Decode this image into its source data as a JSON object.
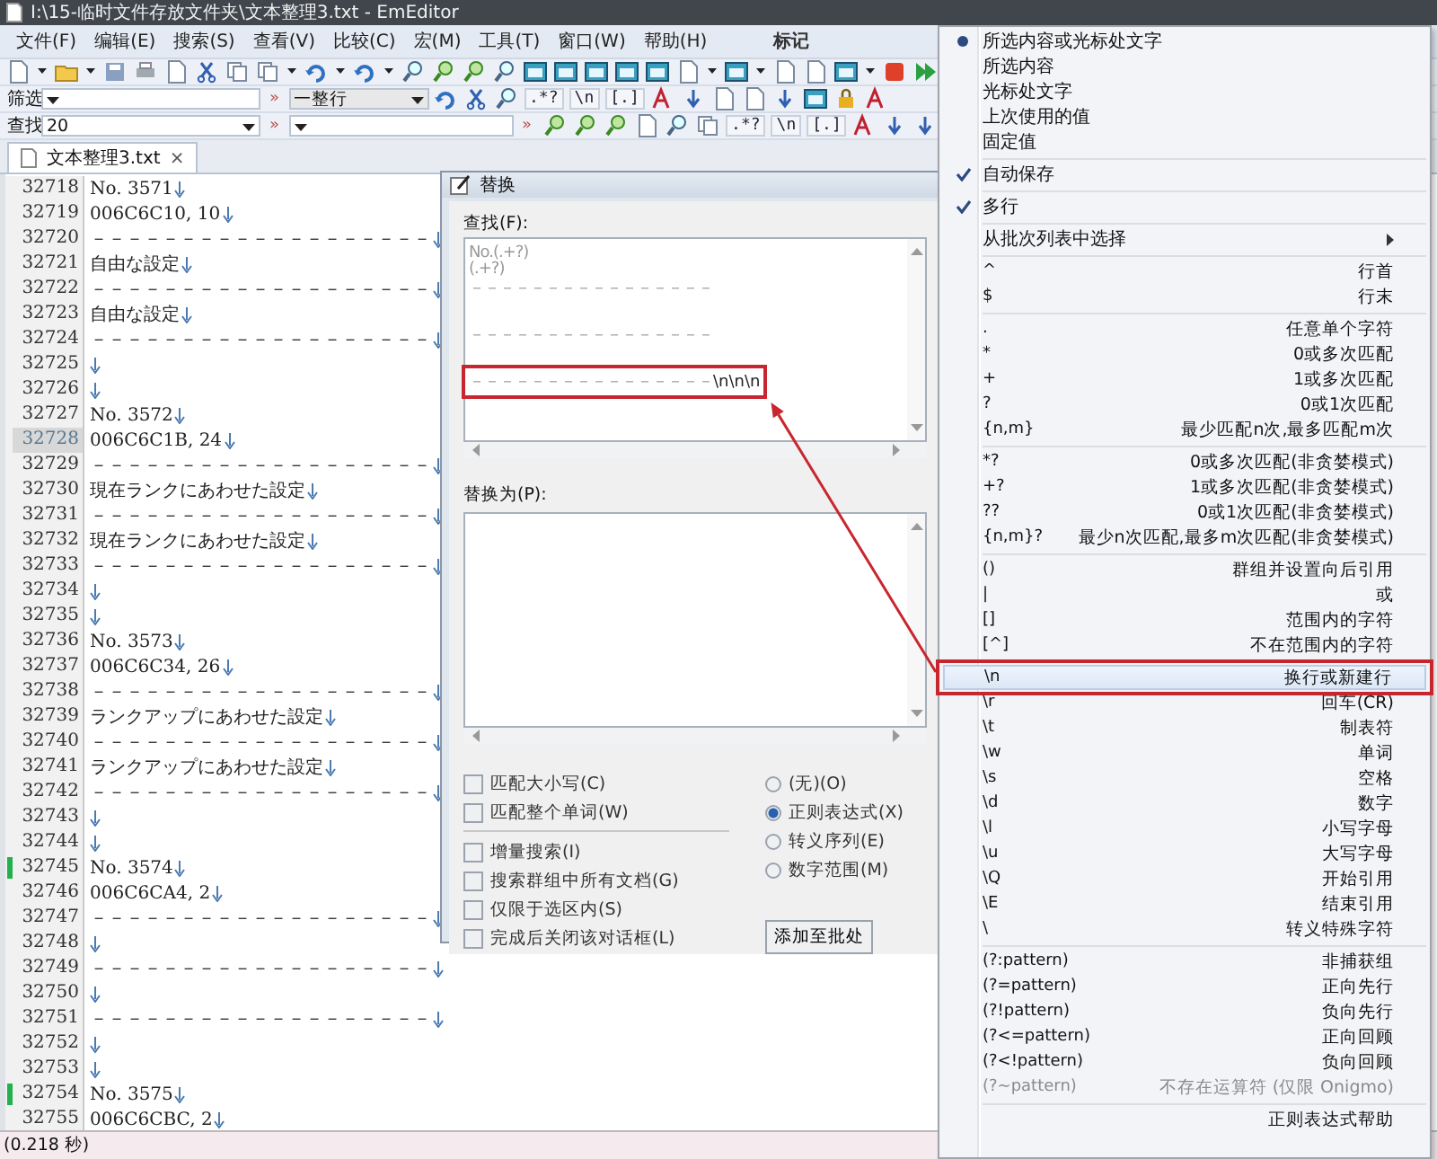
{
  "window": {
    "title": "I:\\15-临时文件存放文件夹\\文本整理3.txt - EmEditor"
  },
  "menu_bar": {
    "items": [
      "文件(F)",
      "编辑(E)",
      "搜索(S)",
      "查看(V)",
      "比较(C)",
      "宏(M)",
      "工具(T)",
      "窗口(W)",
      "帮助(H)"
    ],
    "extra": "标记"
  },
  "filter_bar": {
    "label": "筛选",
    "separator": "»",
    "mode": "一整行",
    "buttons": [
      ".*?",
      "\\n",
      "[.]"
    ]
  },
  "find_bar": {
    "label": "查找",
    "value": "20",
    "separators": [
      "»",
      "»"
    ],
    "buttons": [
      ".*?",
      "\\n",
      "[.]"
    ]
  },
  "tabs": [
    {
      "label": "文本整理3.txt",
      "selected": true,
      "close": "×"
    }
  ],
  "editor": {
    "lines": [
      {
        "number": "32718",
        "text": "No. 3571",
        "current": false,
        "marked": false
      },
      {
        "number": "32719",
        "text": "006C6C10, 10",
        "current": false,
        "marked": false
      },
      {
        "number": "32720",
        "text": "－－－－－－－－－－－－－－－－－－－",
        "current": false,
        "marked": false
      },
      {
        "number": "32721",
        "text": "自由な設定",
        "current": false,
        "marked": false
      },
      {
        "number": "32722",
        "text": "－－－－－－－－－－－－－－－－－－－",
        "current": false,
        "marked": false
      },
      {
        "number": "32723",
        "text": "自由な設定",
        "current": false,
        "marked": false
      },
      {
        "number": "32724",
        "text": "－－－－－－－－－－－－－－－－－－－",
        "current": false,
        "marked": false
      },
      {
        "number": "32725",
        "current": false,
        "marked": false
      },
      {
        "number": "32726",
        "current": false,
        "marked": false
      },
      {
        "number": "32727",
        "text": "No. 3572",
        "current": false,
        "marked": false
      },
      {
        "number": "32728",
        "text": "006C6C1B, 24",
        "current": true,
        "marked": false
      },
      {
        "number": "32729",
        "text": "－－－－－－－－－－－－－－－－－－－",
        "current": false,
        "marked": false
      },
      {
        "number": "32730",
        "text": "現在ランクにあわせた設定",
        "current": false,
        "marked": false
      },
      {
        "number": "32731",
        "text": "－－－－－－－－－－－－－－－－－－－",
        "current": false,
        "marked": false
      },
      {
        "number": "32732",
        "text": "現在ランクにあわせた設定",
        "current": false,
        "marked": false
      },
      {
        "number": "32733",
        "text": "－－－－－－－－－－－－－－－－－－－",
        "current": false,
        "marked": false
      },
      {
        "number": "32734",
        "current": false,
        "marked": false
      },
      {
        "number": "32735",
        "current": false,
        "marked": false
      },
      {
        "number": "32736",
        "text": "No. 3573",
        "current": false,
        "marked": false
      },
      {
        "number": "32737",
        "text": "006C6C34, 26",
        "current": false,
        "marked": false
      },
      {
        "number": "32738",
        "text": "－－－－－－－－－－－－－－－－－－－",
        "current": false,
        "marked": false
      },
      {
        "number": "32739",
        "text": "ランクアップにあわせた設定",
        "current": false,
        "marked": false
      },
      {
        "number": "32740",
        "text": "－－－－－－－－－－－－－－－－－－－",
        "current": false,
        "marked": false
      },
      {
        "number": "32741",
        "text": "ランクアップにあわせた設定",
        "current": false,
        "marked": false
      },
      {
        "number": "32742",
        "text": "－－－－－－－－－－－－－－－－－－－",
        "current": false,
        "marked": false
      },
      {
        "number": "32743",
        "current": false,
        "marked": false
      },
      {
        "number": "32744",
        "current": false,
        "marked": false
      },
      {
        "number": "32745",
        "text": "No. 3574",
        "current": false,
        "marked": true
      },
      {
        "number": "32746",
        "text": "006C6CA4, 2",
        "current": false,
        "marked": false
      },
      {
        "number": "32747",
        "text": "－－－－－－－－－－－－－－－－－－－",
        "current": false,
        "marked": false
      },
      {
        "number": "32748",
        "current": false,
        "marked": false
      },
      {
        "number": "32749",
        "text": "－－－－－－－－－－－－－－－－－－－",
        "current": false,
        "marked": false
      },
      {
        "number": "32750",
        "current": false,
        "marked": false
      },
      {
        "number": "32751",
        "text": "－－－－－－－－－－－－－－－－－－－",
        "current": false,
        "marked": false
      },
      {
        "number": "32752",
        "current": false,
        "marked": false
      },
      {
        "number": "32753",
        "current": false,
        "marked": false
      },
      {
        "number": "32754",
        "text": "No. 3575",
        "current": false,
        "marked": true
      },
      {
        "number": "32755",
        "text": "006C6CBC, 2",
        "current": false,
        "marked": false
      }
    ]
  },
  "status_bar": {
    "text": "(0.218 秒)"
  },
  "dialog": {
    "title": "替换",
    "find_label": "查找(F):",
    "find_lines": [
      {
        "kind": "text",
        "text": "No.(.+?)"
      },
      {
        "kind": "text",
        "text": "(.+?)"
      },
      {
        "kind": "text",
        "text": "－－－－－－－－－－－－－－－－"
      },
      {
        "kind": "blank"
      },
      {
        "kind": "text",
        "text": "－－－－－－－－－－－－－－－－"
      },
      {
        "kind": "blank"
      },
      {
        "kind": "text",
        "text": "－－－－－－－－－－－－－－－－",
        "suffix": "\\n\\n\\n",
        "framed": true
      }
    ],
    "replace_label": "替换为(P):",
    "checkboxes": [
      {
        "label": "匹配大小写(C)",
        "checked": false
      },
      {
        "label": "匹配整个单词(W)",
        "checked": false
      },
      {
        "label": "增量搜索(I)",
        "checked": false,
        "group_start": true
      },
      {
        "label": "搜索群组中所有文档(G)",
        "checked": false
      },
      {
        "label": "仅限于选区内(S)",
        "checked": false
      },
      {
        "label": "完成后关闭该对话框(L)",
        "checked": false
      }
    ],
    "radios": [
      {
        "label": "(无)(O)",
        "selected": false
      },
      {
        "label": "正则表达式(X)",
        "selected": true
      },
      {
        "label": "转义序列(E)",
        "selected": false
      },
      {
        "label": "数字范围(M)",
        "selected": false
      }
    ],
    "button": "添加至批处"
  },
  "menu": {
    "items": [
      {
        "kind": "radio",
        "label": "所选内容或光标处文字",
        "selected": true
      },
      {
        "kind": "radio",
        "label": "所选内容",
        "selected": false
      },
      {
        "kind": "radio",
        "label": "光标处文字",
        "selected": false
      },
      {
        "kind": "radio",
        "label": "上次使用的值",
        "selected": false
      },
      {
        "kind": "radio",
        "label": "固定值",
        "selected": false
      },
      {
        "kind": "separator"
      },
      {
        "kind": "check",
        "label": "自动保存",
        "checked": true
      },
      {
        "kind": "separator"
      },
      {
        "kind": "check",
        "label": "多行",
        "checked": true
      },
      {
        "kind": "separator"
      },
      {
        "kind": "submenu",
        "label": "从批次列表中选择"
      },
      {
        "kind": "separator"
      },
      {
        "kind": "regex",
        "pattern": "^",
        "description": "行首",
        "highlighted": false,
        "disabled": false
      },
      {
        "kind": "regex",
        "pattern": "$",
        "description": "行末",
        "highlighted": false,
        "disabled": false
      },
      {
        "kind": "separator"
      },
      {
        "kind": "regex",
        "pattern": ".",
        "description": "任意单个字符",
        "highlighted": false,
        "disabled": false
      },
      {
        "kind": "regex",
        "pattern": "*",
        "description": "0或多次匹配",
        "highlighted": false,
        "disabled": false
      },
      {
        "kind": "regex",
        "pattern": "+",
        "description": "1或多次匹配",
        "highlighted": false,
        "disabled": false
      },
      {
        "kind": "regex",
        "pattern": "?",
        "description": "0或1次匹配",
        "highlighted": false,
        "disabled": false
      },
      {
        "kind": "regex",
        "pattern": "{n,m}",
        "description": "最少匹配n次,最多匹配m次",
        "highlighted": false,
        "disabled": false
      },
      {
        "kind": "separator"
      },
      {
        "kind": "regex",
        "pattern": "*?",
        "description": "0或多次匹配(非贪婪模式)",
        "highlighted": false,
        "disabled": false
      },
      {
        "kind": "regex",
        "pattern": "+?",
        "description": "1或多次匹配(非贪婪模式)",
        "highlighted": false,
        "disabled": false
      },
      {
        "kind": "regex",
        "pattern": "??",
        "description": "0或1次匹配(非贪婪模式)",
        "highlighted": false,
        "disabled": false
      },
      {
        "kind": "regex",
        "pattern": "{n,m}?",
        "description": "最少n次匹配,最多m次匹配(非贪婪模式)",
        "highlighted": false,
        "disabled": false
      },
      {
        "kind": "separator"
      },
      {
        "kind": "regex",
        "pattern": "()",
        "description": "群组并设置向后引用",
        "highlighted": false,
        "disabled": false
      },
      {
        "kind": "regex",
        "pattern": "|",
        "description": "或",
        "highlighted": false,
        "disabled": false
      },
      {
        "kind": "regex",
        "pattern": "[]",
        "description": "范围内的字符",
        "highlighted": false,
        "disabled": false
      },
      {
        "kind": "regex",
        "pattern": "[^]",
        "description": "不在范围内的字符",
        "highlighted": false,
        "disabled": false
      },
      {
        "kind": "separator"
      },
      {
        "kind": "regex",
        "pattern": "\\n",
        "description": "换行或新建行",
        "highlighted": true,
        "disabled": false
      },
      {
        "kind": "regex",
        "pattern": "\\r",
        "description": "回车(CR)",
        "highlighted": false,
        "disabled": false
      },
      {
        "kind": "regex",
        "pattern": "\\t",
        "description": "制表符",
        "highlighted": false,
        "disabled": false
      },
      {
        "kind": "regex",
        "pattern": "\\w",
        "description": "单词",
        "highlighted": false,
        "disabled": false
      },
      {
        "kind": "regex",
        "pattern": "\\s",
        "description": "空格",
        "highlighted": false,
        "disabled": false
      },
      {
        "kind": "regex",
        "pattern": "\\d",
        "description": "数字",
        "highlighted": false,
        "disabled": false
      },
      {
        "kind": "regex",
        "pattern": "\\l",
        "description": "小写字母",
        "highlighted": false,
        "disabled": false
      },
      {
        "kind": "regex",
        "pattern": "\\u",
        "description": "大写字母",
        "highlighted": false,
        "disabled": false
      },
      {
        "kind": "regex",
        "pattern": "\\Q",
        "description": "开始引用",
        "highlighted": false,
        "disabled": false
      },
      {
        "kind": "regex",
        "pattern": "\\E",
        "description": "结束引用",
        "highlighted": false,
        "disabled": false
      },
      {
        "kind": "regex",
        "pattern": "\\",
        "description": "转义特殊字符",
        "highlighted": false,
        "disabled": false
      },
      {
        "kind": "separator"
      },
      {
        "kind": "regex",
        "pattern": "(?:pattern)",
        "description": "非捕获组",
        "highlighted": false,
        "disabled": false
      },
      {
        "kind": "regex",
        "pattern": "(?=pattern)",
        "description": "正向先行",
        "highlighted": false,
        "disabled": false
      },
      {
        "kind": "regex",
        "pattern": "(?!pattern)",
        "description": "负向先行",
        "highlighted": false,
        "disabled": false
      },
      {
        "kind": "regex",
        "pattern": "(?<=pattern)",
        "description": "正向回顾",
        "highlighted": false,
        "disabled": false
      },
      {
        "kind": "regex",
        "pattern": "(?<!pattern)",
        "description": "负向回顾",
        "highlighted": false,
        "disabled": false
      },
      {
        "kind": "regex",
        "pattern": "(?~pattern)",
        "description": "不存在运算符 (仅限 Onigmo)",
        "highlighted": false,
        "disabled": true
      },
      {
        "kind": "separator"
      },
      {
        "kind": "command",
        "label": "正则表达式帮助"
      }
    ]
  }
}
